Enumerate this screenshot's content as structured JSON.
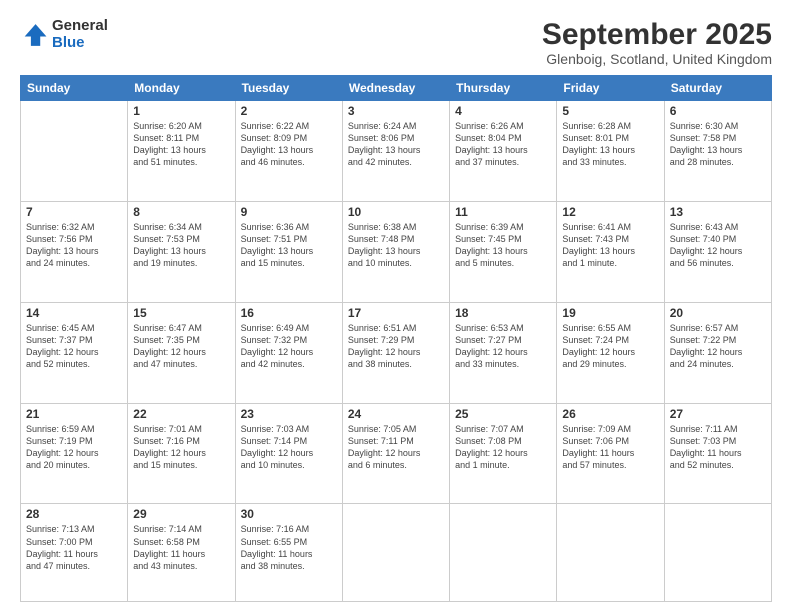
{
  "logo": {
    "general": "General",
    "blue": "Blue"
  },
  "header": {
    "month": "September 2025",
    "location": "Glenboig, Scotland, United Kingdom"
  },
  "days": [
    "Sunday",
    "Monday",
    "Tuesday",
    "Wednesday",
    "Thursday",
    "Friday",
    "Saturday"
  ],
  "weeks": [
    [
      {
        "day": "",
        "info": ""
      },
      {
        "day": "1",
        "info": "Sunrise: 6:20 AM\nSunset: 8:11 PM\nDaylight: 13 hours\nand 51 minutes."
      },
      {
        "day": "2",
        "info": "Sunrise: 6:22 AM\nSunset: 8:09 PM\nDaylight: 13 hours\nand 46 minutes."
      },
      {
        "day": "3",
        "info": "Sunrise: 6:24 AM\nSunset: 8:06 PM\nDaylight: 13 hours\nand 42 minutes."
      },
      {
        "day": "4",
        "info": "Sunrise: 6:26 AM\nSunset: 8:04 PM\nDaylight: 13 hours\nand 37 minutes."
      },
      {
        "day": "5",
        "info": "Sunrise: 6:28 AM\nSunset: 8:01 PM\nDaylight: 13 hours\nand 33 minutes."
      },
      {
        "day": "6",
        "info": "Sunrise: 6:30 AM\nSunset: 7:58 PM\nDaylight: 13 hours\nand 28 minutes."
      }
    ],
    [
      {
        "day": "7",
        "info": "Sunrise: 6:32 AM\nSunset: 7:56 PM\nDaylight: 13 hours\nand 24 minutes."
      },
      {
        "day": "8",
        "info": "Sunrise: 6:34 AM\nSunset: 7:53 PM\nDaylight: 13 hours\nand 19 minutes."
      },
      {
        "day": "9",
        "info": "Sunrise: 6:36 AM\nSunset: 7:51 PM\nDaylight: 13 hours\nand 15 minutes."
      },
      {
        "day": "10",
        "info": "Sunrise: 6:38 AM\nSunset: 7:48 PM\nDaylight: 13 hours\nand 10 minutes."
      },
      {
        "day": "11",
        "info": "Sunrise: 6:39 AM\nSunset: 7:45 PM\nDaylight: 13 hours\nand 5 minutes."
      },
      {
        "day": "12",
        "info": "Sunrise: 6:41 AM\nSunset: 7:43 PM\nDaylight: 13 hours\nand 1 minute."
      },
      {
        "day": "13",
        "info": "Sunrise: 6:43 AM\nSunset: 7:40 PM\nDaylight: 12 hours\nand 56 minutes."
      }
    ],
    [
      {
        "day": "14",
        "info": "Sunrise: 6:45 AM\nSunset: 7:37 PM\nDaylight: 12 hours\nand 52 minutes."
      },
      {
        "day": "15",
        "info": "Sunrise: 6:47 AM\nSunset: 7:35 PM\nDaylight: 12 hours\nand 47 minutes."
      },
      {
        "day": "16",
        "info": "Sunrise: 6:49 AM\nSunset: 7:32 PM\nDaylight: 12 hours\nand 42 minutes."
      },
      {
        "day": "17",
        "info": "Sunrise: 6:51 AM\nSunset: 7:29 PM\nDaylight: 12 hours\nand 38 minutes."
      },
      {
        "day": "18",
        "info": "Sunrise: 6:53 AM\nSunset: 7:27 PM\nDaylight: 12 hours\nand 33 minutes."
      },
      {
        "day": "19",
        "info": "Sunrise: 6:55 AM\nSunset: 7:24 PM\nDaylight: 12 hours\nand 29 minutes."
      },
      {
        "day": "20",
        "info": "Sunrise: 6:57 AM\nSunset: 7:22 PM\nDaylight: 12 hours\nand 24 minutes."
      }
    ],
    [
      {
        "day": "21",
        "info": "Sunrise: 6:59 AM\nSunset: 7:19 PM\nDaylight: 12 hours\nand 20 minutes."
      },
      {
        "day": "22",
        "info": "Sunrise: 7:01 AM\nSunset: 7:16 PM\nDaylight: 12 hours\nand 15 minutes."
      },
      {
        "day": "23",
        "info": "Sunrise: 7:03 AM\nSunset: 7:14 PM\nDaylight: 12 hours\nand 10 minutes."
      },
      {
        "day": "24",
        "info": "Sunrise: 7:05 AM\nSunset: 7:11 PM\nDaylight: 12 hours\nand 6 minutes."
      },
      {
        "day": "25",
        "info": "Sunrise: 7:07 AM\nSunset: 7:08 PM\nDaylight: 12 hours\nand 1 minute."
      },
      {
        "day": "26",
        "info": "Sunrise: 7:09 AM\nSunset: 7:06 PM\nDaylight: 11 hours\nand 57 minutes."
      },
      {
        "day": "27",
        "info": "Sunrise: 7:11 AM\nSunset: 7:03 PM\nDaylight: 11 hours\nand 52 minutes."
      }
    ],
    [
      {
        "day": "28",
        "info": "Sunrise: 7:13 AM\nSunset: 7:00 PM\nDaylight: 11 hours\nand 47 minutes."
      },
      {
        "day": "29",
        "info": "Sunrise: 7:14 AM\nSunset: 6:58 PM\nDaylight: 11 hours\nand 43 minutes."
      },
      {
        "day": "30",
        "info": "Sunrise: 7:16 AM\nSunset: 6:55 PM\nDaylight: 11 hours\nand 38 minutes."
      },
      {
        "day": "",
        "info": ""
      },
      {
        "day": "",
        "info": ""
      },
      {
        "day": "",
        "info": ""
      },
      {
        "day": "",
        "info": ""
      }
    ]
  ]
}
